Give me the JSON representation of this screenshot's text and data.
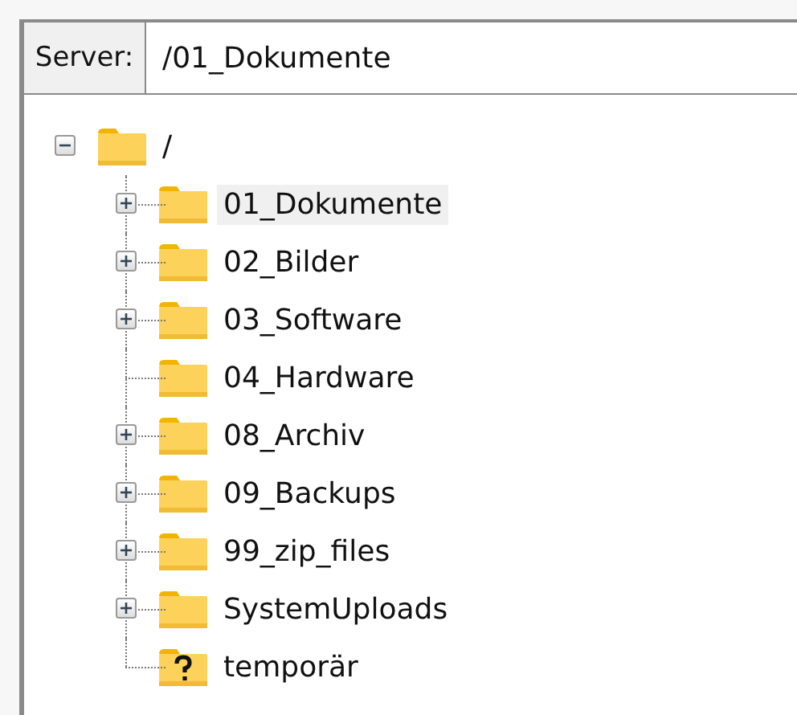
{
  "server_bar": {
    "label": "Server:",
    "path": "/01_Dokumente"
  },
  "tree": {
    "label": "/",
    "kind": "folder",
    "expanded": true,
    "children": [
      {
        "label": "01_Dokumente",
        "kind": "folder",
        "expandable": true,
        "selected": true
      },
      {
        "label": "02_Bilder",
        "kind": "folder",
        "expandable": true,
        "selected": false
      },
      {
        "label": "03_Software",
        "kind": "folder",
        "expandable": true,
        "selected": false
      },
      {
        "label": "04_Hardware",
        "kind": "folder",
        "expandable": false,
        "selected": false
      },
      {
        "label": "08_Archiv",
        "kind": "folder",
        "expandable": true,
        "selected": false
      },
      {
        "label": "09_Backups",
        "kind": "folder",
        "expandable": true,
        "selected": false
      },
      {
        "label": "99_zip_files",
        "kind": "folder",
        "expandable": true,
        "selected": false
      },
      {
        "label": "SystemUploads",
        "kind": "folder",
        "expandable": true,
        "selected": false
      },
      {
        "label": "temporär",
        "kind": "unknown",
        "expandable": false,
        "selected": false
      }
    ]
  }
}
